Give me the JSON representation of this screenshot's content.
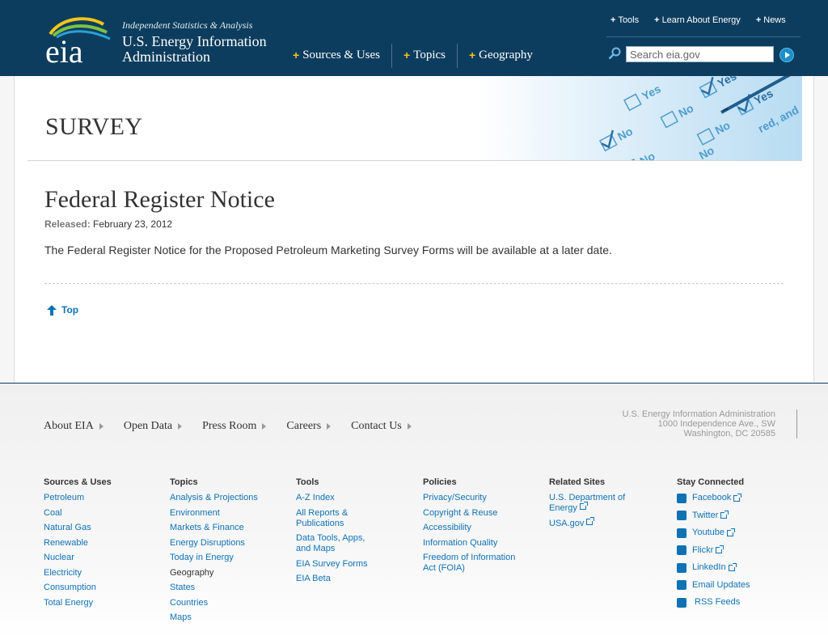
{
  "header": {
    "tagline": "Independent Statistics & Analysis",
    "org_line1": "U.S. Energy Information",
    "org_line2": "Administration",
    "logo_text": "eia",
    "main_nav": [
      "Sources & Uses",
      "Topics",
      "Geography"
    ],
    "util_nav": [
      "Tools",
      "Learn About Energy",
      "News"
    ],
    "search_placeholder": "Search eia.gov"
  },
  "banner": {
    "title": "SURVEY",
    "image_words": [
      "Yes",
      "No",
      "No",
      "Yes",
      "No",
      "Yes",
      "No",
      "No",
      "red, and"
    ]
  },
  "main": {
    "title": "Federal Register Notice",
    "released_label": "Released:",
    "released_date": "February 23, 2012",
    "body": "The Federal Register Notice for the Proposed Petroleum Marketing Survey Forms will be available at a later date.",
    "top_link": "Top"
  },
  "footer": {
    "nav": [
      "About EIA",
      "Open Data",
      "Press Room",
      "Careers",
      "Contact Us"
    ],
    "address": [
      "U.S. Energy Information Administration",
      "1000 Independence Ave., SW",
      "Washington, DC 20585"
    ],
    "columns": [
      {
        "heading": "Sources & Uses",
        "links": [
          "Petroleum",
          "Coal",
          "Natural Gas",
          "Renewable",
          "Nuclear",
          "Electricity",
          "Consumption",
          "Total Energy"
        ]
      },
      {
        "heading": "Topics",
        "links": [
          "Analysis & Projections",
          "Environment",
          "Markets & Finance",
          "Energy Disruptions",
          "Today in Energy"
        ],
        "subheading": "Geography",
        "sublinks": [
          "States",
          "Countries",
          "Maps"
        ]
      },
      {
        "heading": "Tools",
        "links": [
          "A-Z Index",
          "All Reports & Publications",
          "Data Tools, Apps, and Maps",
          "EIA Survey Forms",
          "EIA Beta"
        ]
      },
      {
        "heading": "Policies",
        "links": [
          "Privacy/Security",
          "Copyright & Reuse",
          "Accessibility",
          "Information Quality",
          "Freedom of Information Act (FOIA)"
        ]
      },
      {
        "heading": "Related Sites",
        "links": [
          "U.S. Department of Energy",
          "USA.gov"
        ]
      },
      {
        "heading": "Stay Connected",
        "social": [
          {
            "label": "Facebook",
            "icon": "facebook-icon"
          },
          {
            "label": "Twitter",
            "icon": "twitter-icon"
          },
          {
            "label": "Youtube",
            "icon": "youtube-icon"
          },
          {
            "label": "Flickr",
            "icon": "flickr-icon"
          },
          {
            "label": "LinkedIn",
            "icon": "linkedin-icon"
          },
          {
            "label": "Email Updates",
            "icon": "email-icon"
          },
          {
            "label": "RSS Feeds",
            "icon": "rss-icon"
          }
        ]
      }
    ]
  },
  "colors": {
    "header_bg": "#0d3d5e",
    "link": "#0f72b5",
    "accent_plus": "#f5c518"
  }
}
